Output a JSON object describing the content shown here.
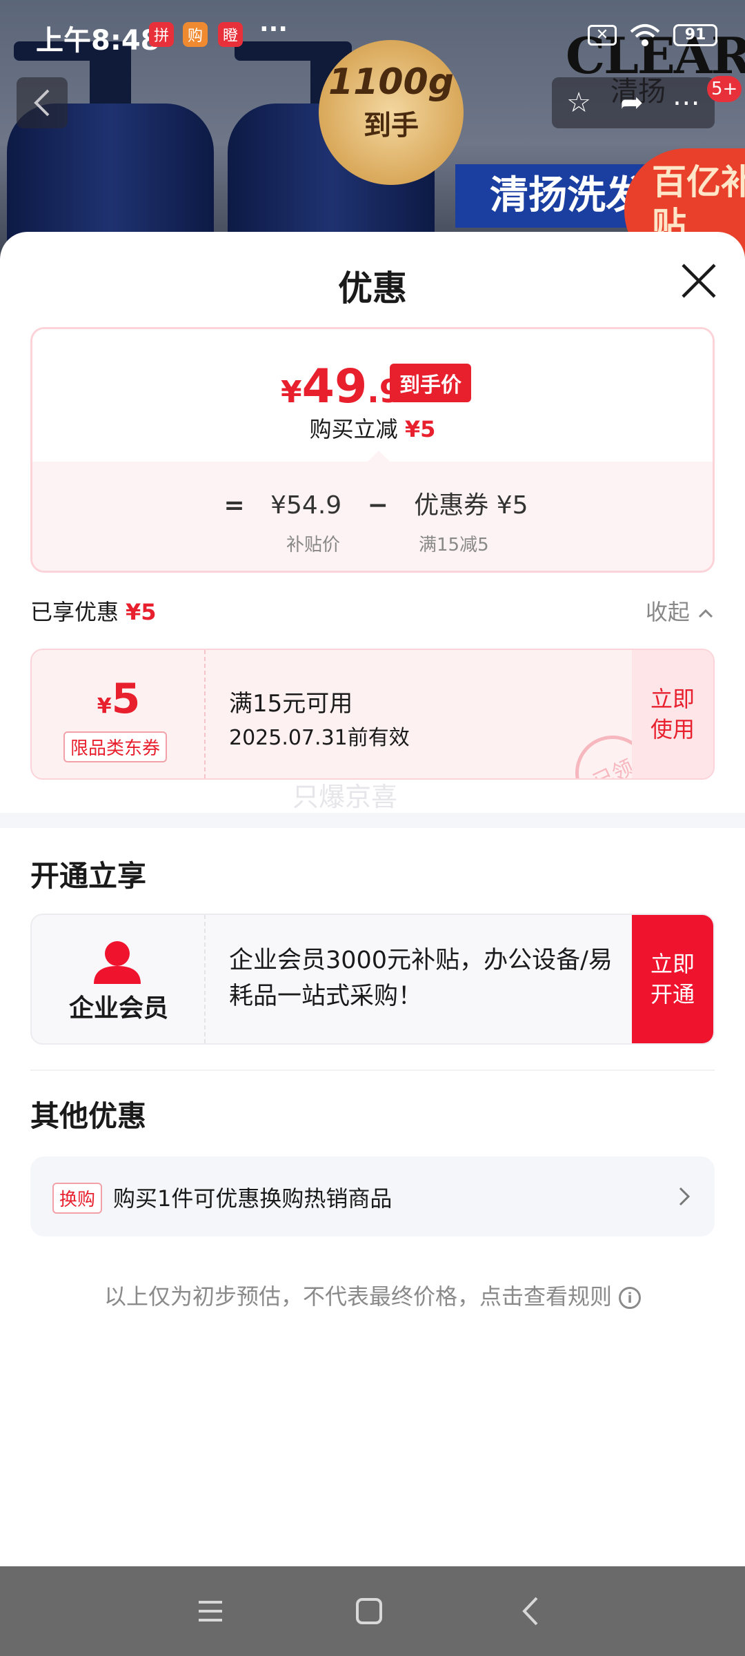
{
  "status_bar": {
    "time": "上午8:48",
    "app_icons": [
      "拼",
      "购",
      "瞪"
    ],
    "more": "···",
    "battery": "91"
  },
  "product_banner": {
    "weight_badge_big": "1100g",
    "weight_badge_small": "到手",
    "brand_logo": "CLEAR",
    "brand_logo_cn": "清扬",
    "banner_text": "清扬洗发",
    "corner_badge": "百亿补贴",
    "cart_badge": "5+"
  },
  "sheet": {
    "title": "优惠",
    "price_card": {
      "yen": "¥",
      "price_int": "49",
      "price_dec": ".9",
      "price_tag": "到手价",
      "reduce_label": "购买立减",
      "reduce_amount": "¥5",
      "formula_eq": "=",
      "formula_subsidy_price": "¥54.9",
      "formula_minus": "−",
      "formula_coupon": "优惠券 ¥5",
      "formula_subsidy_label": "补贴价",
      "formula_coupon_label": "满15减5"
    },
    "enjoyed": {
      "label": "已享优惠",
      "amount": "¥5",
      "collapse": "收起"
    },
    "coupon": {
      "yen": "¥",
      "amount": "5",
      "type": "限品类东券",
      "condition": "满15元可用",
      "expiry": "2025.07.31前有效",
      "use_button": "立即使用",
      "stamp": "已领"
    },
    "watermark": "只爆京喜",
    "open_section": {
      "title": "开通立享",
      "member_name": "企业会员",
      "member_desc": "企业会员3000元补贴，办公设备/易耗品一站式采购！",
      "open_button": "立即开通"
    },
    "other_section": {
      "title": "其他优惠",
      "tag": "换购",
      "text": "购买1件可优惠换购热销商品"
    },
    "disclaimer": "以上仅为初步预估，不代表最终价格，点击查看规则",
    "info_icon": "i"
  },
  "colors": {
    "accent_red": "#e8202e",
    "member_button_red": "#f0132e",
    "coupon_bg": "#fdf1f2"
  }
}
